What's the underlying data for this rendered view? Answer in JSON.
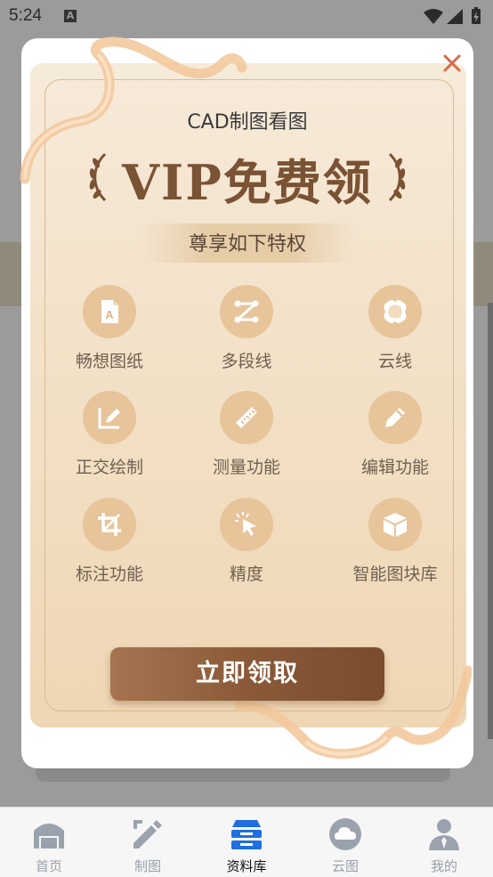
{
  "status_bar": {
    "time": "5:24",
    "notif_letter": "A"
  },
  "modal": {
    "app_name": "CAD制图看图",
    "title": "VIP免费领",
    "subtitle": "尊享如下特权",
    "features": [
      {
        "label": "畅想图纸",
        "icon": "drawing-file-icon"
      },
      {
        "label": "多段线",
        "icon": "polyline-icon"
      },
      {
        "label": "云线",
        "icon": "cloud-line-icon"
      },
      {
        "label": "正交绘制",
        "icon": "ortho-draw-icon"
      },
      {
        "label": "测量功能",
        "icon": "ruler-icon"
      },
      {
        "label": "编辑功能",
        "icon": "edit-pencil-icon"
      },
      {
        "label": "标注功能",
        "icon": "crop-annotate-icon"
      },
      {
        "label": "精度",
        "icon": "precision-cursor-icon"
      },
      {
        "label": "智能图块库",
        "icon": "block-cube-icon"
      }
    ],
    "cta_label": "立即领取",
    "colors": {
      "accent": "#8a5a38",
      "title": "#7a5234",
      "icon_bg": "#e7c49a"
    }
  },
  "tab_bar": {
    "tabs": [
      {
        "label": "首页",
        "icon": "home-icon",
        "active": false
      },
      {
        "label": "制图",
        "icon": "draw-pencil-icon",
        "active": false
      },
      {
        "label": "资料库",
        "icon": "library-stack-icon",
        "active": true
      },
      {
        "label": "云图",
        "icon": "cloud-icon",
        "active": false
      },
      {
        "label": "我的",
        "icon": "user-icon",
        "active": false
      }
    ]
  }
}
